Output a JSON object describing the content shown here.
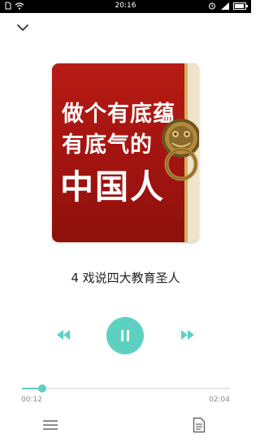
{
  "status_bar": {
    "time": "20:16",
    "left_icons": [
      "sim-icon",
      "wifi-icon"
    ],
    "right_icons": [
      "alarm-icon",
      "signal-icon",
      "battery-icon"
    ],
    "battery_level": 0.9
  },
  "header": {
    "collapse_icon": "chevron-down-icon"
  },
  "cover": {
    "line1": "做个有底蕴",
    "line2": "有底气的",
    "line3": "中国人"
  },
  "track": {
    "title": "4 戏说四大教育圣人"
  },
  "controls": {
    "prev_icon": "rewind-icon",
    "play_icon": "pause-icon",
    "next_icon": "fast-forward-icon"
  },
  "progress": {
    "elapsed": "00:12",
    "total": "02:04",
    "fraction": 0.097
  },
  "bottom": {
    "left_icon": "playlist-icon",
    "right_icon": "document-icon"
  },
  "colors": {
    "accent": "#5ed0c2",
    "cover_red": "#a21410",
    "cover_gold": "#d4b063"
  }
}
